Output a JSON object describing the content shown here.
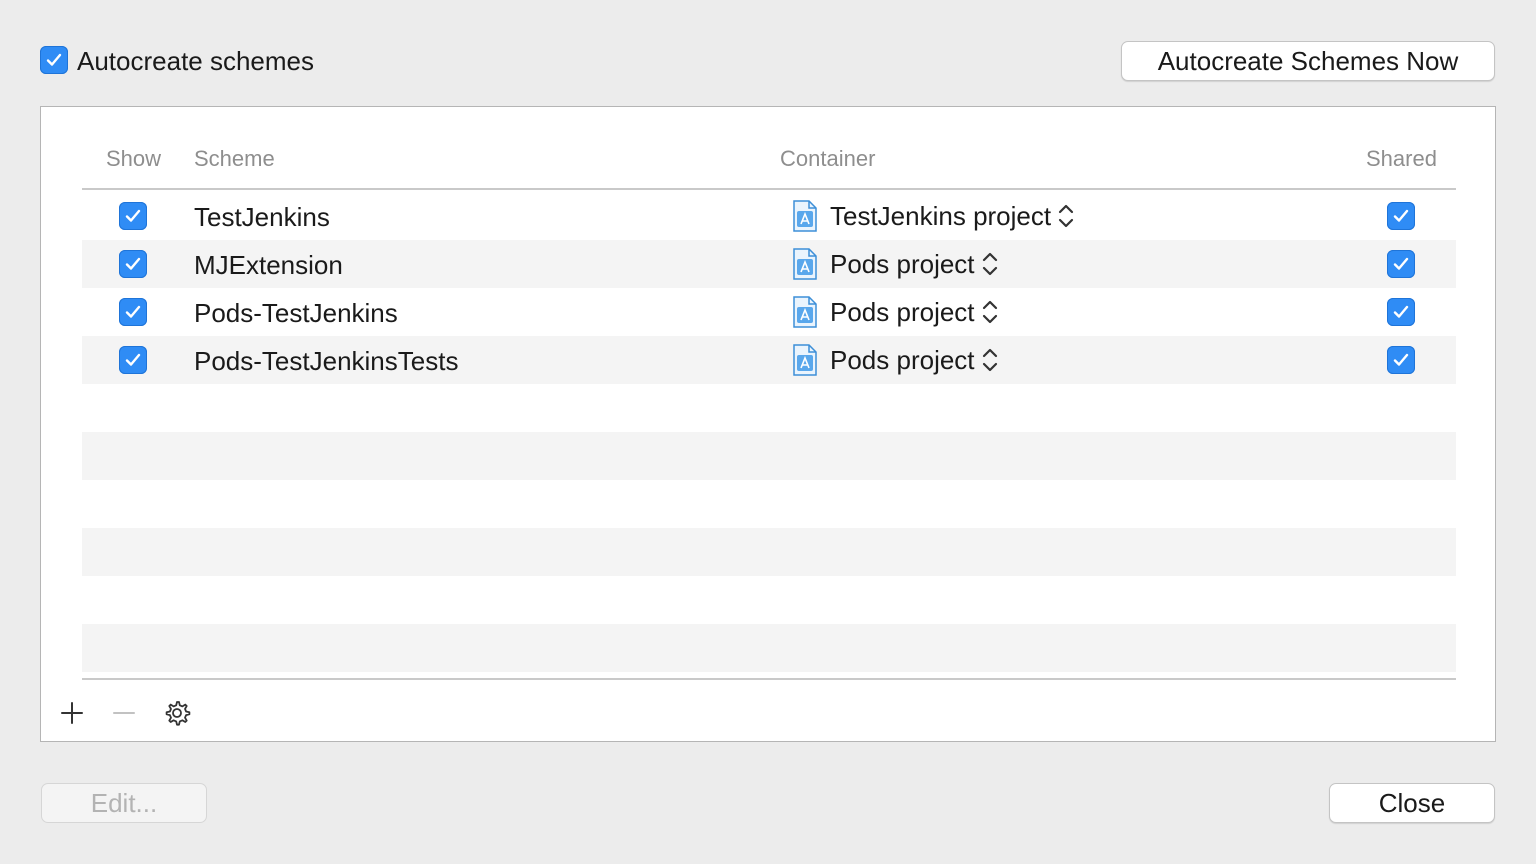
{
  "top": {
    "autocreate_label": "Autocreate schemes",
    "autocreate_checked": true,
    "autocreate_now_button": "Autocreate Schemes Now"
  },
  "table": {
    "columns": {
      "show": "Show",
      "scheme": "Scheme",
      "container": "Container",
      "shared": "Shared"
    },
    "rows": [
      {
        "show": true,
        "scheme": "TestJenkins",
        "container": "TestJenkins project",
        "shared": true
      },
      {
        "show": true,
        "scheme": "MJExtension",
        "container": "Pods project",
        "shared": true
      },
      {
        "show": true,
        "scheme": "Pods-TestJenkins",
        "container": "Pods project",
        "shared": true
      },
      {
        "show": true,
        "scheme": "Pods-TestJenkinsTests",
        "container": "Pods project",
        "shared": true
      }
    ]
  },
  "toolbar": {
    "add_icon": "plus-icon",
    "remove_icon": "minus-icon",
    "settings_icon": "gear-icon"
  },
  "bottom": {
    "edit_button": "Edit...",
    "close_button": "Close"
  },
  "colors": {
    "accent": "#2f8cf5",
    "background": "#ececec"
  }
}
